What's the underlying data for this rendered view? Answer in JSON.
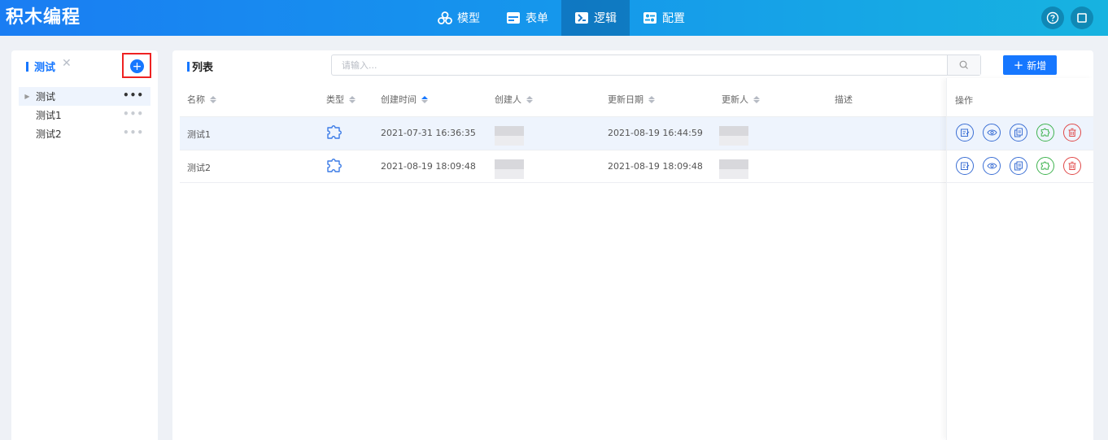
{
  "header": {
    "logo": "积木编程",
    "nav": [
      {
        "label": "模型",
        "icon": "model-icon",
        "active": false
      },
      {
        "label": "表单",
        "icon": "form-icon",
        "active": false
      },
      {
        "label": "逻辑",
        "icon": "logic-icon",
        "active": true
      },
      {
        "label": "配置",
        "icon": "config-icon",
        "active": false
      }
    ],
    "actions": [
      "help-icon",
      "window-icon"
    ]
  },
  "left_panel": {
    "tab_label": "测试",
    "tree": [
      {
        "label": "测试",
        "level": 0
      },
      {
        "label": "测试1",
        "level": 1
      },
      {
        "label": "测试2",
        "level": 1
      }
    ],
    "more": "•••"
  },
  "main": {
    "title": "列表",
    "search_placeholder": "请输入...",
    "new_button": "新增",
    "columns": {
      "name": "名称",
      "type": "类型",
      "created_time": "创建时间",
      "creator": "创建人",
      "updated_date": "更新日期",
      "updater": "更新人",
      "description": "描述",
      "ops": "操作"
    },
    "rows": [
      {
        "name": "测试1",
        "type_icon": "puzzle-icon",
        "created_time": "2021-07-31 16:36:35",
        "updated_date": "2021-08-19 16:44:59"
      },
      {
        "name": "测试2",
        "type_icon": "puzzle-icon",
        "created_time": "2021-08-19 18:09:48",
        "updated_date": "2021-08-19 18:09:48"
      }
    ],
    "op_icons": [
      "edit-icon",
      "view-icon",
      "copy-icon",
      "puzzle-icon",
      "delete-icon"
    ]
  },
  "colors": {
    "primary": "#1677ff",
    "danger": "#e04848",
    "success": "#3fb34f"
  }
}
